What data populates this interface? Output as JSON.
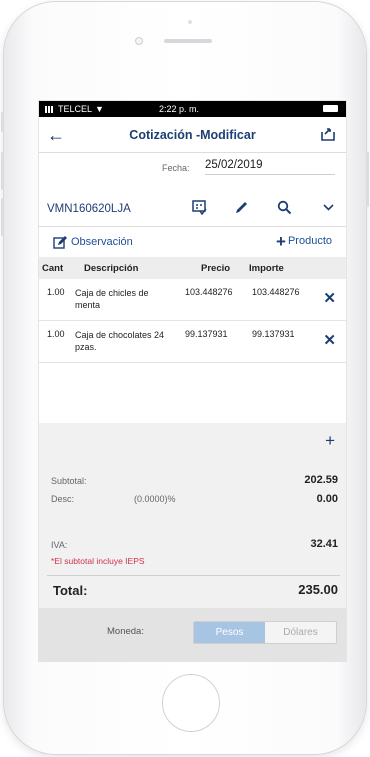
{
  "status_bar": {
    "carrier": "TELCEL",
    "time": "2:22 p. m."
  },
  "header": {
    "title": "Cotización -Modificar"
  },
  "form": {
    "date_label": "Fecha:",
    "date_value": "25/02/2019",
    "client_code": "VMN160620LJA"
  },
  "actions": {
    "observation_label": "Observación",
    "product_label": "Producto"
  },
  "table": {
    "headers": [
      "Cant",
      "Descripción",
      "Precio",
      "Importe"
    ],
    "rows": [
      {
        "cant": "1.00",
        "desc": "Caja de chicles de menta",
        "precio": "103.448276",
        "importe": "103.448276"
      },
      {
        "cant": "1.00",
        "desc": "Caja de chocolates 24 pzas.",
        "precio": "99.137931",
        "importe": "99.137931"
      }
    ]
  },
  "totals": {
    "subtotal_label": "Subtotal:",
    "subtotal_value": "202.59",
    "desc_label": "Desc:",
    "desc_percent": "(0.0000)%",
    "desc_value": "0.00",
    "iva_label": "IVA:",
    "iva_value": "32.41",
    "note": "*El subtotal incluye IEPS",
    "total_label": "Total:",
    "total_value": "235.00"
  },
  "currency": {
    "label": "Moneda:",
    "options": [
      "Pesos",
      "Dólares"
    ],
    "selected": "Pesos"
  },
  "colors": {
    "primary": "#1d3e73",
    "accent": "#a7c4e3",
    "warning": "#d0324a"
  }
}
